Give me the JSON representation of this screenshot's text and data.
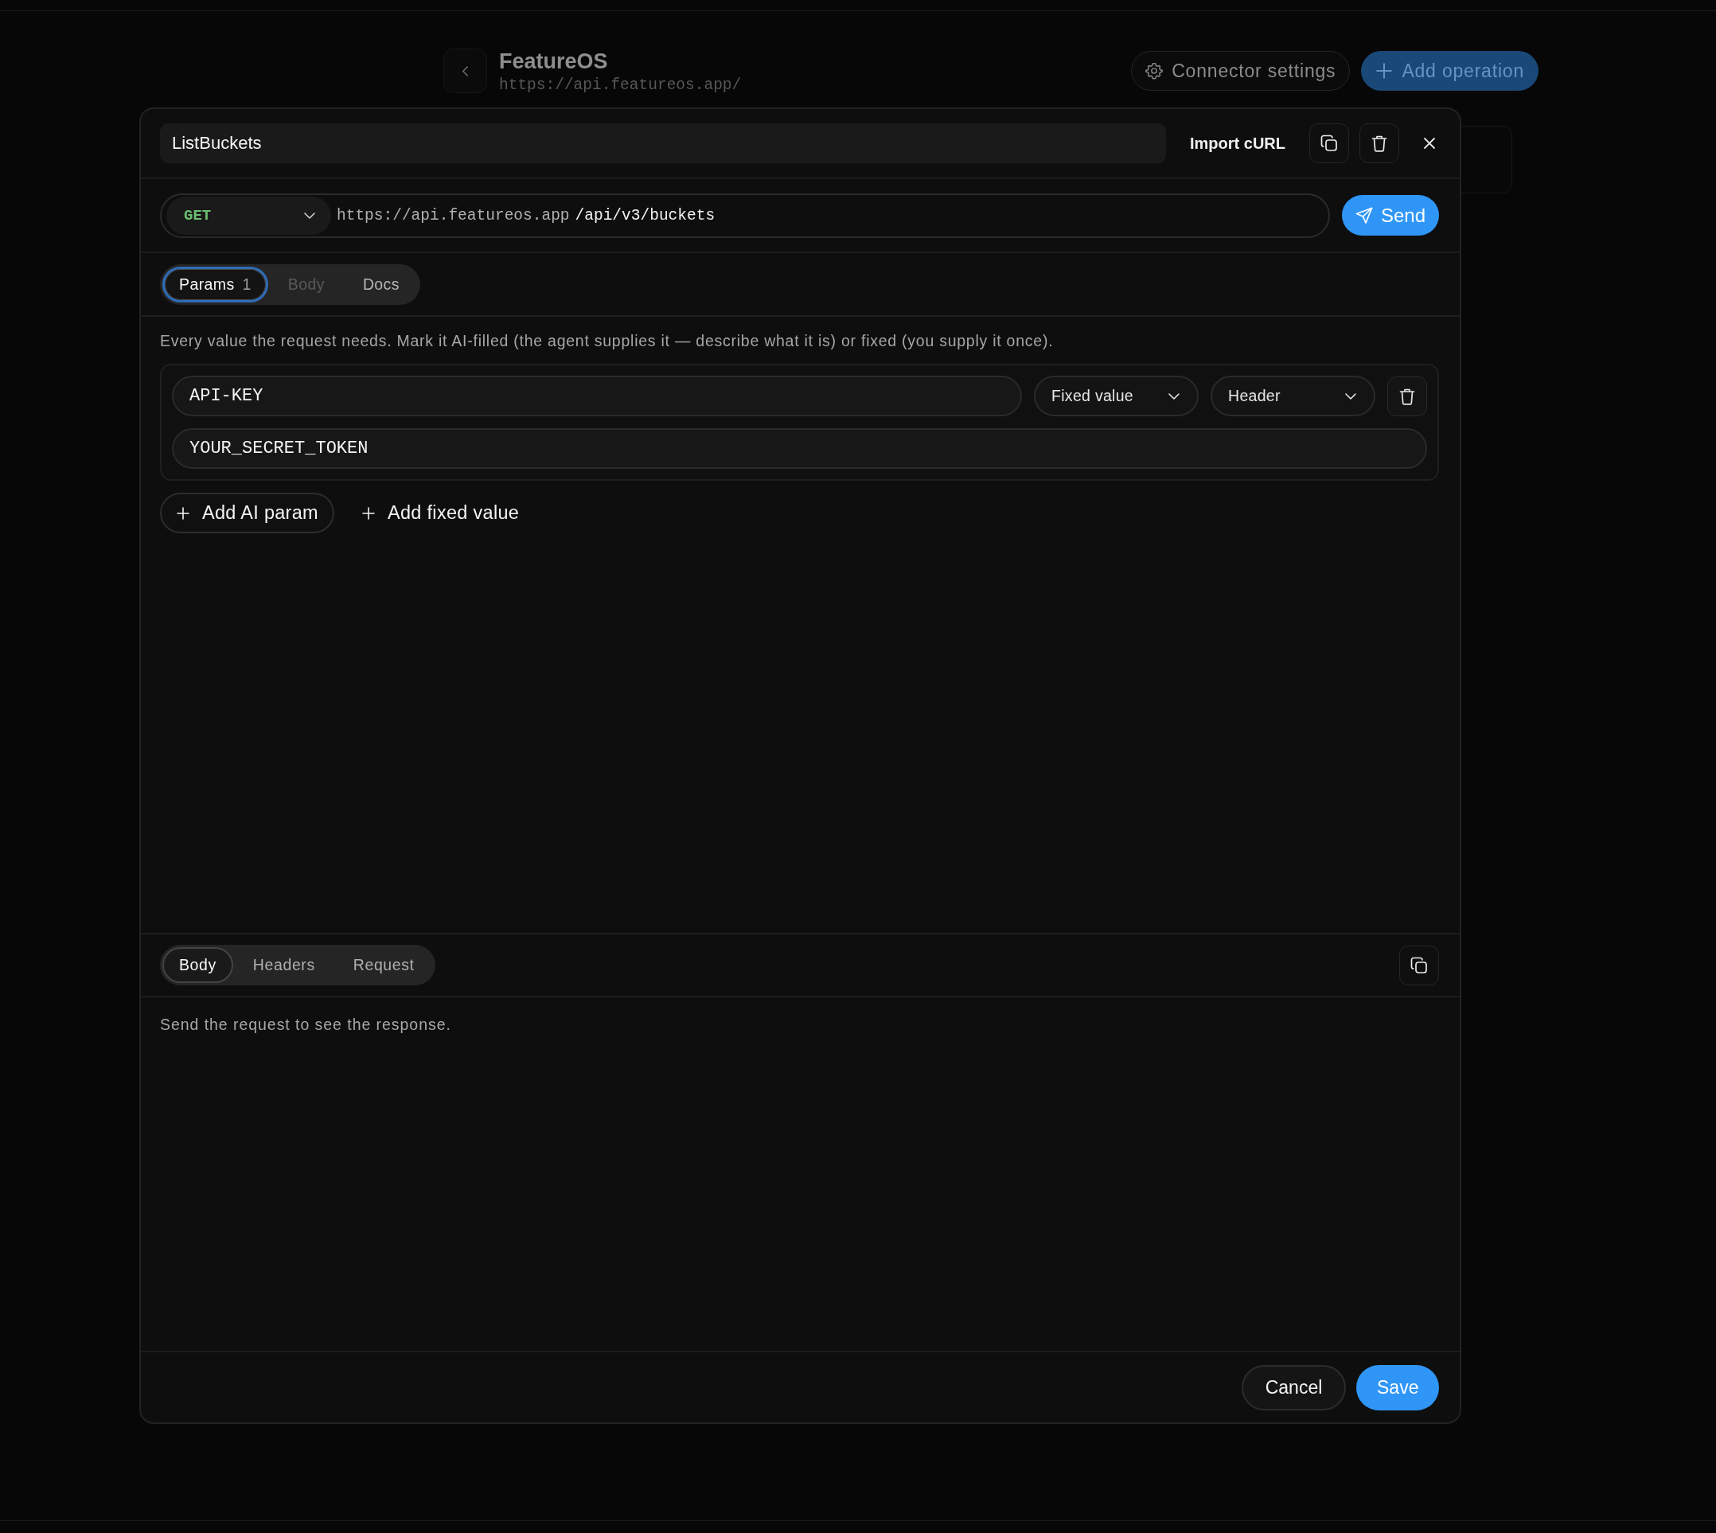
{
  "background_page": {
    "title": "FeatureOS",
    "base_url": "https://api.featureos.app/",
    "buttons": [
      {
        "label": "Connector settings",
        "kind": "secondary"
      },
      {
        "label": "Add operation",
        "kind": "primary"
      }
    ]
  },
  "dialog": {
    "operation_name": "ListBuckets",
    "import_button": "Import cURL",
    "method": "GET",
    "base_url": "https://api.featureos.app",
    "path": "/api/v3/buckets",
    "send_button": "Send",
    "request_tabs": [
      {
        "label": "Params",
        "count": "1",
        "selected": true,
        "disabled": false
      },
      {
        "label": "Body",
        "selected": false,
        "disabled": true
      },
      {
        "label": "Docs",
        "selected": false,
        "disabled": false
      }
    ],
    "description": "Every value the request needs. Mark it AI-filled (the agent supplies it — describe what it is) or fixed (you supply it once).",
    "params": [
      {
        "name": "API-KEY",
        "mode": "Fixed value",
        "location": "Header",
        "value": "YOUR_SECRET_TOKEN"
      }
    ],
    "add_buttons": [
      {
        "label": "Add AI param",
        "kind": "outlined"
      },
      {
        "label": "Add fixed value",
        "kind": "plain"
      }
    ],
    "response_tabs": [
      {
        "label": "Body",
        "selected": true
      },
      {
        "label": "Headers",
        "selected": false
      },
      {
        "label": "Request",
        "selected": false
      }
    ],
    "response_message": "Send the request to see the response.",
    "footer_buttons": [
      {
        "label": "Cancel",
        "kind": "secondary"
      },
      {
        "label": "Save",
        "kind": "primary"
      }
    ]
  }
}
